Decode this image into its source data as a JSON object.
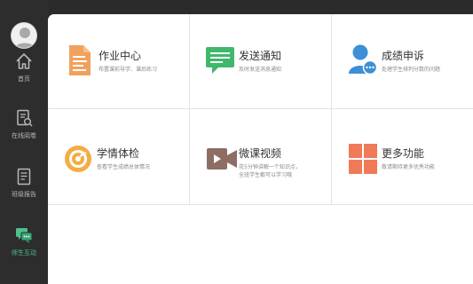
{
  "nav": {
    "items": [
      {
        "label": "首页",
        "icon": "home-icon",
        "active": false
      },
      {
        "label": "在线阅卷",
        "icon": "marking-icon",
        "active": false
      },
      {
        "label": "班级报告",
        "icon": "report-icon",
        "active": false
      },
      {
        "label": "师生互动",
        "icon": "chat-icon",
        "active": true
      }
    ],
    "active_color": "#4fc08d"
  },
  "tiles": [
    {
      "title": "作业中心",
      "desc": "布置课前导学、课后练习",
      "icon": "document-icon",
      "color": "#f0a25d"
    },
    {
      "title": "发送通知",
      "desc": "及时发送消息通知",
      "icon": "message-icon",
      "color": "#3fb86b"
    },
    {
      "title": "成绩申诉",
      "desc": "处理学生排判分数的问题",
      "icon": "user-appeal-icon",
      "color": "#3d8fd6"
    },
    {
      "title": "学情体检",
      "desc": "查看学生成绩总体情况",
      "icon": "checkup-icon",
      "color": "#f3ad43"
    },
    {
      "title": "微课视频",
      "desc_lines": [
        "花5分钟讲解一个知识点，",
        "全班学生都可以学习哦"
      ],
      "icon": "video-camera-icon",
      "color": "#8d6e63"
    },
    {
      "title": "更多功能",
      "desc": "敬请期待更多优秀功能",
      "icon": "grid-icon",
      "color": "#f07a57"
    }
  ]
}
